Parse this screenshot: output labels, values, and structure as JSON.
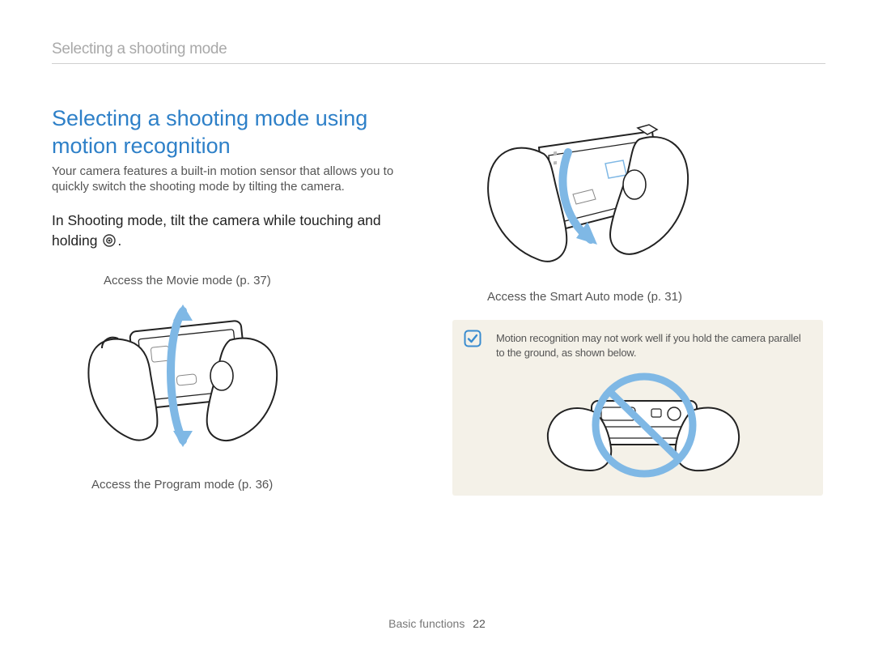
{
  "running_head": "Selecting a shooting mode",
  "heading": "Selecting a shooting mode using motion recognition",
  "intro": "Your camera features a built-in motion sensor that allows you to quickly switch the shooting mode by tilting the camera.",
  "step_pre": "In Shooting mode, tilt the camera while touching and holding ",
  "step_post": ".",
  "captions": {
    "movie": "Access the Movie mode (p. 37)",
    "program": "Access the Program mode (p. 36)",
    "smart_auto": "Access the Smart Auto mode (p. 31)"
  },
  "note_text": "Motion recognition may not work well if you hold the camera parallel to the ground, as shown below.",
  "footer_section": "Basic functions",
  "footer_page": "22",
  "icons": {
    "step_glyph": "motion-target-icon",
    "note_glyph": "note-box-check-icon"
  }
}
